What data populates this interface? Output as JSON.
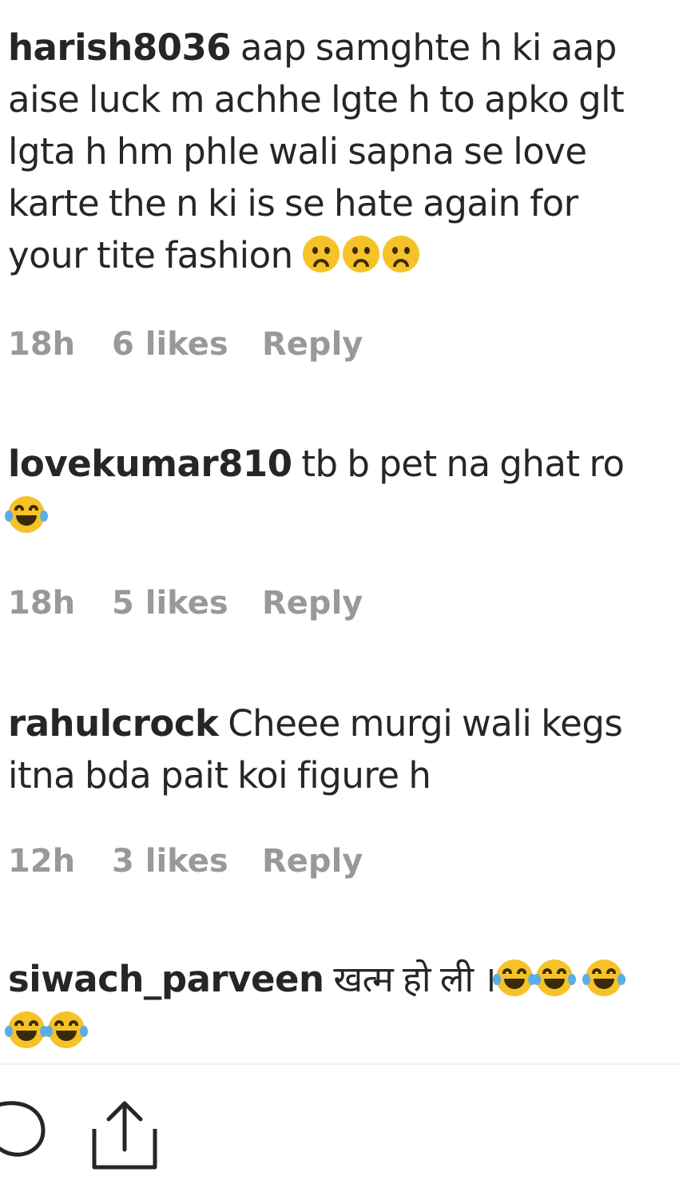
{
  "comments": [
    {
      "username": "harish8036",
      "text": "aap samghte h ki aap aise luck m achhe lgte h to apko glt lgta h hm phle wali sapna se love karte the n ki is se hate again for your tite fashion",
      "emojis": [
        "frowning-face",
        "frowning-face",
        "frowning-face"
      ],
      "time": "18h",
      "likes": "6 likes",
      "reply_label": "Reply"
    },
    {
      "username": "lovekumar810",
      "text": "tb b pet na ghat ro",
      "emojis": [
        "tears-of-joy-face"
      ],
      "time": "18h",
      "likes": "5 likes",
      "reply_label": "Reply"
    },
    {
      "username": "rahulcrock",
      "text": "Cheee murgi wali kegs itna bda pait koi figure h",
      "emojis": [],
      "time": "12h",
      "likes": "3 likes",
      "reply_label": "Reply"
    },
    {
      "username": "siwach_parveen",
      "text": "खत्म हो ली ।",
      "emojis": [
        "tears-of-joy-face",
        "tears-of-joy-face",
        "tears-of-joy-face",
        "tears-of-joy-face",
        "tears-of-joy-face"
      ]
    }
  ],
  "action_bar": {
    "icons": [
      "comment-icon",
      "share-icon"
    ]
  },
  "colors": {
    "text": "#262626",
    "meta": "#999999",
    "divider": "#efefef",
    "emoji_yellow": "#f6c228"
  }
}
